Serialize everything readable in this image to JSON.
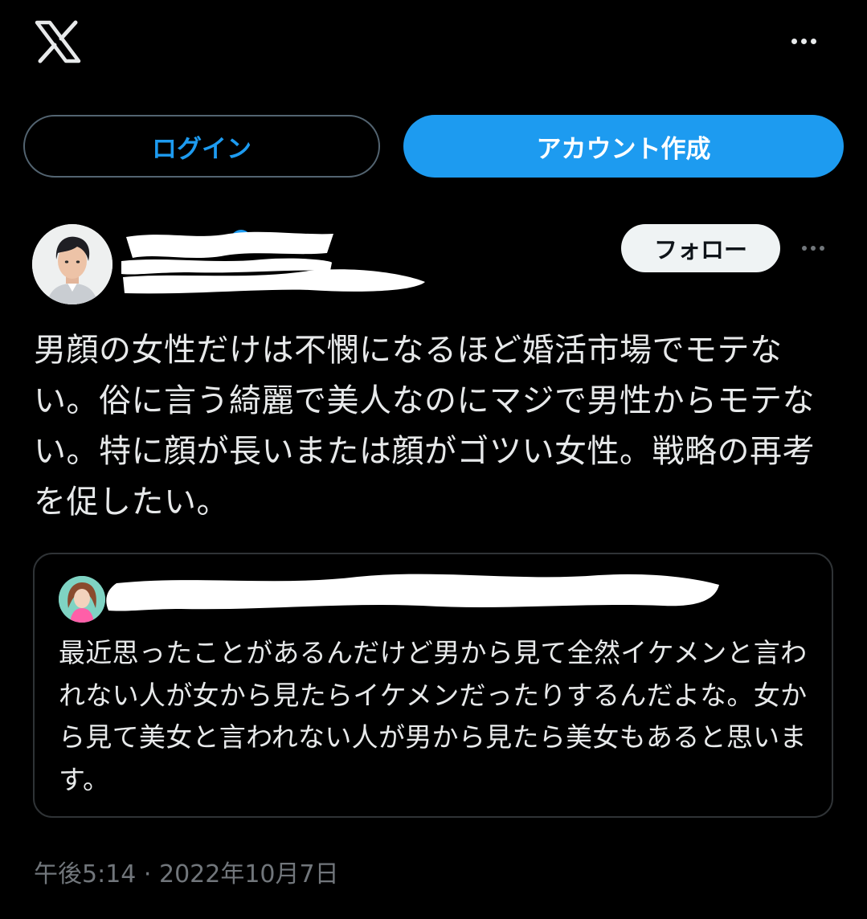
{
  "header": {
    "logo_icon": "x-logo-icon",
    "more_icon": "more-horizontal-icon"
  },
  "auth": {
    "login_label": "ログイン",
    "signup_label": "アカウント作成"
  },
  "tweet": {
    "follow_label": "フォロー",
    "verified_icon": "verified-badge-icon",
    "text": "男顔の女性だけは不憫になるほど婚活市場でモテない。俗に言う綺麗で美人なのにマジで男性からモテない。特に顔が長いまたは顔がゴツい女性。戦略の再考を促したい。",
    "quoted": {
      "text": "最近思ったことがあるんだけど男から見て全然イケメンと言われない人が女から見たらイケメンだったりするんだよな。女から見て美女と言われない人が男から見たら美女もあると思います。"
    },
    "timestamp": "午後5:14 · 2022年10月7日"
  },
  "colors": {
    "background": "#000000",
    "accent": "#1d9bf0",
    "text": "#e7e9ea",
    "muted": "#71767b",
    "border": "#2f3336"
  }
}
